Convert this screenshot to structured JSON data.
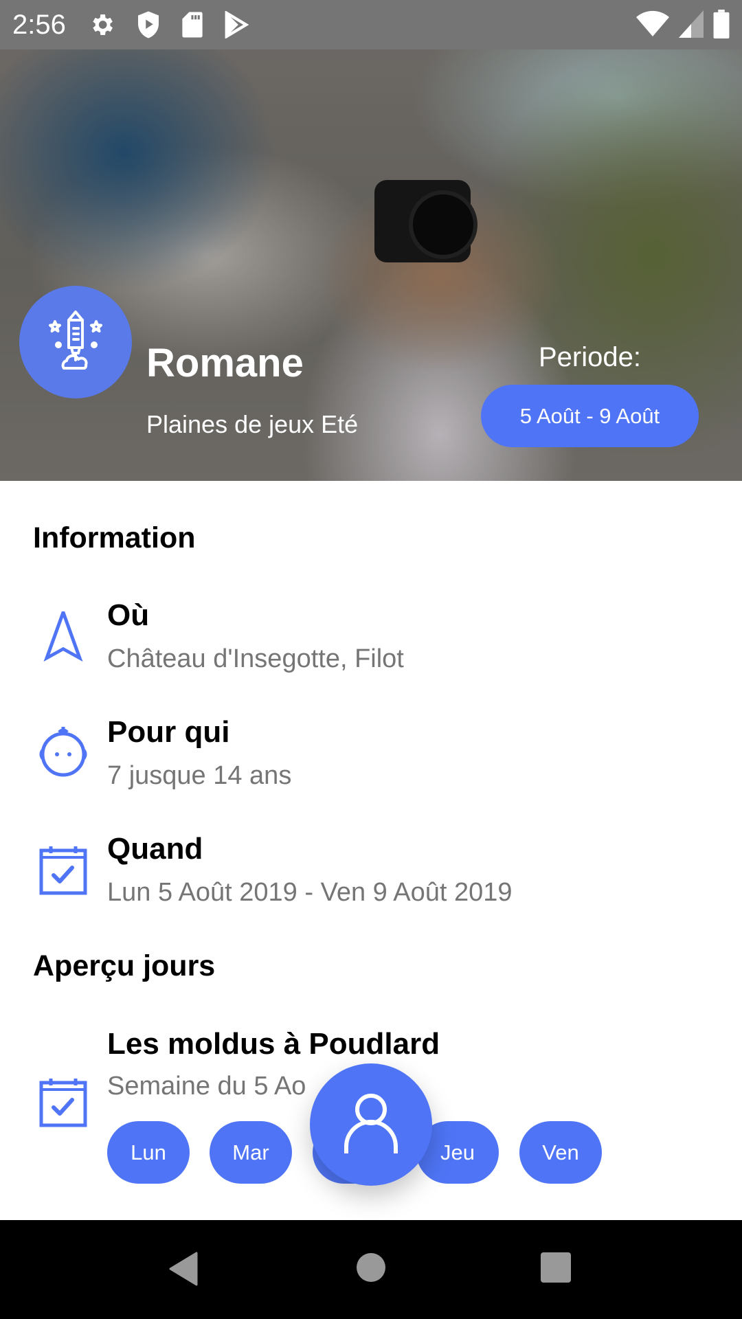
{
  "status_bar": {
    "time": "2:56",
    "left_icons": [
      "gear-icon",
      "shield-play-icon",
      "sd-card-icon",
      "play-store-icon"
    ],
    "right_icons": [
      "wifi-icon",
      "cell-signal-icon",
      "battery-icon"
    ]
  },
  "header": {
    "name": "Romane",
    "subtitle": "Plaines de jeux Eté",
    "avatar_icon": "rocket-icon",
    "period_label": "Periode:",
    "period_value": "5 Août - 9 Août"
  },
  "information": {
    "title": "Information",
    "rows": [
      {
        "icon": "navigation-arrow-icon",
        "label": "Où",
        "value": "Château d'Insegotte, Filot"
      },
      {
        "icon": "baby-face-icon",
        "label": "Pour qui",
        "value": "7 jusque 14 ans"
      },
      {
        "icon": "calendar-check-icon",
        "label": "Quand",
        "value": "Lun 5 Août 2019 - Ven 9 Août 2019"
      }
    ]
  },
  "apercu": {
    "title": "Aperçu jours",
    "week": {
      "icon": "calendar-check-icon",
      "title": "Les moldus à Poudlard",
      "subtitle": "Semaine du 5 Ao",
      "days": [
        "Lun",
        "Mar",
        "",
        "Jeu",
        "Ven"
      ]
    }
  },
  "fab": {
    "icon": "user-icon"
  },
  "nav_bar": {
    "buttons": [
      "back",
      "home",
      "recents"
    ]
  },
  "colors": {
    "accent": "#4f75f6",
    "avatar_bg": "#5a7ae9",
    "muted_text": "#757575",
    "status_bar": "#757575"
  }
}
